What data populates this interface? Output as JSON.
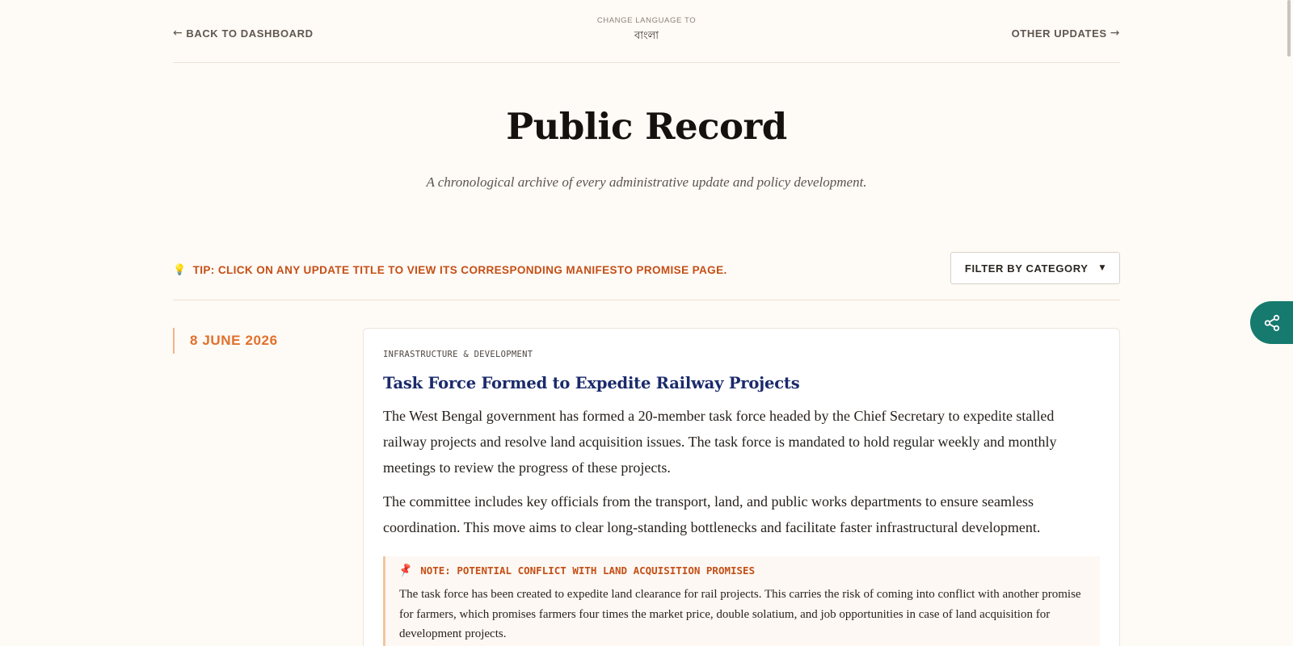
{
  "nav": {
    "back_label": "BACK TO DASHBOARD",
    "back_arrow": "←",
    "language_caption": "CHANGE LANGUAGE TO",
    "language_value": "বাংলা",
    "other_label": "OTHER UPDATES",
    "other_arrow": "→"
  },
  "hero": {
    "title": "Public Record",
    "subtitle": "A chronological archive of every administrative update and policy development."
  },
  "toolbar": {
    "tip_icon": "💡",
    "tip_text": "TIP: CLICK ON ANY UPDATE TITLE TO VIEW ITS CORRESPONDING MANIFESTO PROMISE PAGE.",
    "filter_label": "FILTER BY CATEGORY",
    "filter_caret": "▼"
  },
  "entries": [
    {
      "date": "8 JUNE 2026",
      "category": "INFRASTRUCTURE & DEVELOPMENT",
      "title": "Task Force Formed to Expedite Railway Projects",
      "paragraphs": [
        "The West Bengal government has formed a 20-member task force headed by the Chief Secretary to expedite stalled railway projects and resolve land acquisition issues. The task force is mandated to hold regular weekly and monthly meetings to review the progress of these projects.",
        "The committee includes key officials from the transport, land, and public works departments to ensure seamless coordination. This move aims to clear long-standing bottlenecks and facilitate faster infrastructural development."
      ],
      "note": {
        "icon": "📌",
        "heading": "NOTE: POTENTIAL CONFLICT WITH LAND ACQUISITION PROMISES",
        "body": "The task force has been created to expedite land clearance for rail projects. This carries the risk of coming into conflict with another promise for farmers, which promises farmers four times the market price, double solatium, and job opportunities in case of land acquisition for development projects."
      }
    }
  ],
  "icons": {
    "share_button": "share-icon",
    "bulb": "lightbulb-icon",
    "pin": "pushpin-icon"
  },
  "colors": {
    "background": "#fefaf5",
    "accent_orange": "#c44f16",
    "date_orange": "#e0702c",
    "title_navy": "#1a2a6b",
    "share_teal": "#167a6e"
  }
}
